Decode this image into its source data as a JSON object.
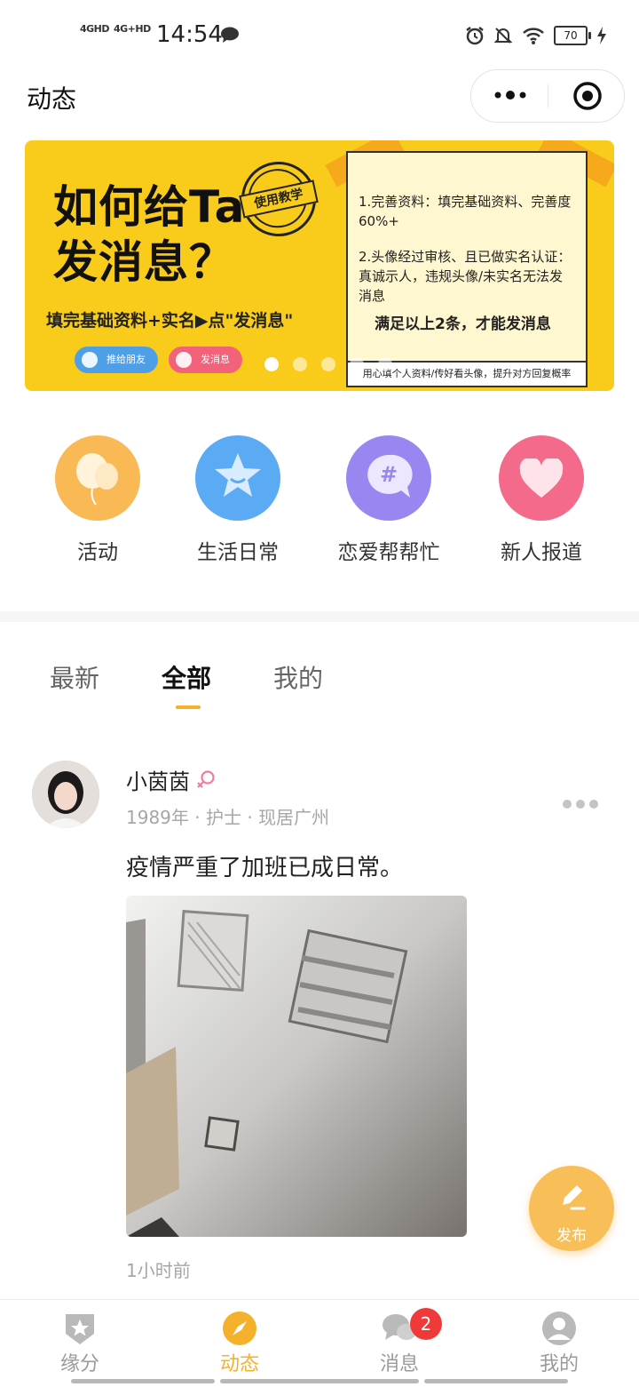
{
  "status_bar": {
    "signal1": "4GHD",
    "signal2": "4G+HD",
    "time": "14:54",
    "battery": "70"
  },
  "header": {
    "title": "动态"
  },
  "banner": {
    "headline_line1": "如何给Ta",
    "headline_line2": "发消息？",
    "stamp": "使用教学",
    "subline": "填完基础资料+实名▶点\"发消息\"",
    "pill_recommend": "推给朋友",
    "pill_message": "发消息",
    "note_item1": "1.完善资料：填完基础资料、完善度60%+",
    "note_item2": "2.头像经过审核、且已做实名认证：真诚示人，违规头像/未实名无法发消息",
    "note_emphasis": "满足以上2条，才能发消息",
    "note_footer": "用心填个人资料/传好看头像，提升对方回复概率",
    "page_count": 5,
    "active_page": 0
  },
  "categories": [
    {
      "label": "活动",
      "icon": "balloon-icon",
      "color": "#f9b955"
    },
    {
      "label": "生活日常",
      "icon": "star-smile-icon",
      "color": "#5aabf4"
    },
    {
      "label": "恋爱帮帮忙",
      "icon": "hashtag-bubble-icon",
      "color": "#9a86f0"
    },
    {
      "label": "新人报道",
      "icon": "heart-icon",
      "color": "#f46a8a"
    }
  ],
  "tabs": [
    {
      "label": "最新",
      "active": false
    },
    {
      "label": "全部",
      "active": true
    },
    {
      "label": "我的",
      "active": false
    }
  ],
  "post": {
    "username": "小茵茵",
    "gender_icon": "female-icon",
    "birth_year": "1989年",
    "occupation": "护士",
    "location": "现居广州",
    "content": "疫情严重了加班已成日常。",
    "time": "1小时前"
  },
  "fab": {
    "label": "发布",
    "icon": "pencil-icon"
  },
  "bottom_nav": [
    {
      "label": "缘分",
      "icon": "shield-star-icon",
      "active": false
    },
    {
      "label": "动态",
      "icon": "compass-icon",
      "active": true
    },
    {
      "label": "消息",
      "icon": "chat-bubbles-icon",
      "active": false,
      "badge": "2"
    },
    {
      "label": "我的",
      "icon": "user-icon",
      "active": false
    }
  ],
  "colors": {
    "accent": "#f5b12b",
    "banner_bg": "#f9cc1c",
    "badge": "#f03a3a"
  }
}
